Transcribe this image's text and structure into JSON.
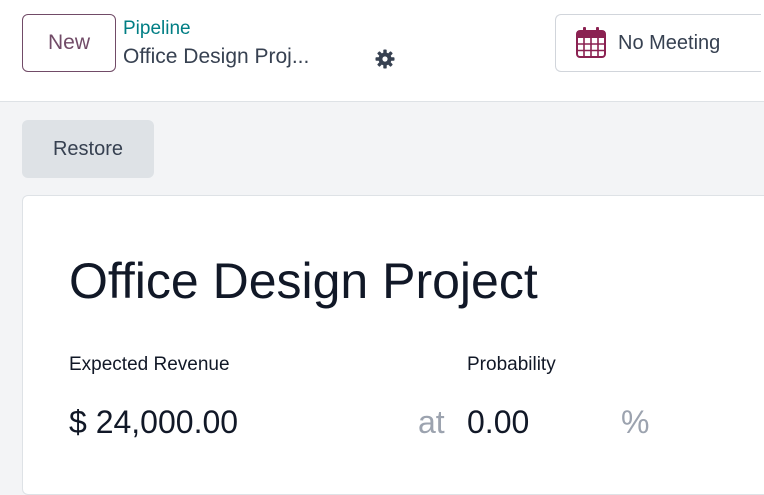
{
  "header": {
    "new_label": "New",
    "breadcrumb_parent": "Pipeline",
    "breadcrumb_current": "Office Design Proj...",
    "meeting_label": "No Meeting"
  },
  "actions": {
    "restore_label": "Restore"
  },
  "form": {
    "title": "Office Design Project",
    "expected_revenue_label": "Expected Revenue",
    "expected_revenue_value": "$ 24,000.00",
    "at_text": "at",
    "probability_label": "Probability",
    "probability_value": "0.00",
    "percent_sign": "%"
  },
  "colors": {
    "brand": "#714b67",
    "link": "#017e84"
  },
  "icons": {
    "gear": "gear-icon",
    "calendar": "calendar-icon"
  }
}
